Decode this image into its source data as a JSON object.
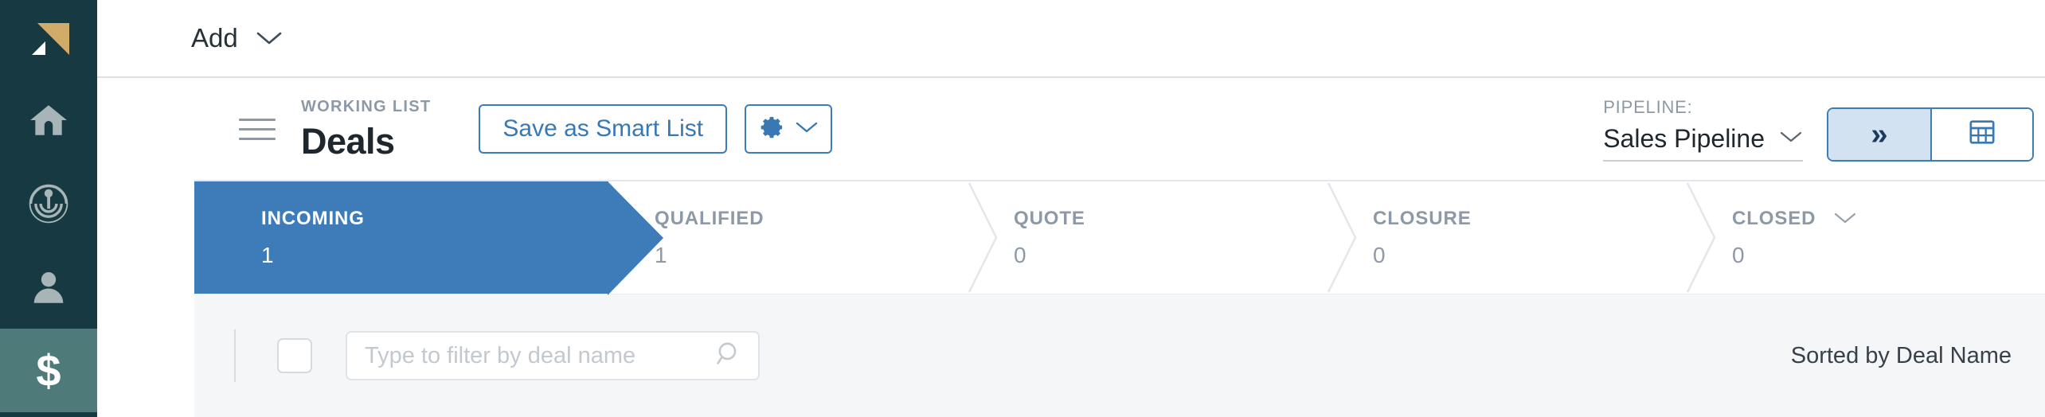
{
  "sidebar": {
    "logo": {
      "icon": "brand-triangle-logo",
      "gold": "#d2ab68"
    },
    "items": [
      {
        "icon": "home-icon",
        "name": "home",
        "active": false
      },
      {
        "icon": "broadcast-icon",
        "name": "marketing",
        "active": false
      },
      {
        "icon": "person-icon",
        "name": "contacts",
        "active": false
      },
      {
        "icon": "dollar-icon",
        "name": "deals",
        "active": true,
        "glyph": "$"
      }
    ],
    "background": "#173a42",
    "active_background": "#4e7a7a"
  },
  "topbar": {
    "add_label": "Add",
    "add_chevron_icon": "chevron-down-icon"
  },
  "listbar": {
    "menu_icon": "hamburger-icon",
    "kicker": "WORKING LIST",
    "title": "Deals",
    "save_smart_list_label": "Save as Smart List",
    "gear_icon": "gear-icon",
    "gear_chevron_icon": "chevron-down-icon",
    "pipeline": {
      "label": "PIPELINE:",
      "value": "Sales Pipeline",
      "chevron_icon": "chevron-down-icon"
    },
    "view_toggle": {
      "pipeline_view_icon": "double-chevron-right-icon",
      "pipeline_view_glyph": "»",
      "table_view_icon": "table-grid-icon",
      "active": "pipeline_view"
    },
    "accent": "#3e7cb9"
  },
  "stages": [
    {
      "name": "INCOMING",
      "count": "1",
      "active": true
    },
    {
      "name": "QUALIFIED",
      "count": "1",
      "active": false
    },
    {
      "name": "QUOTE",
      "count": "0",
      "active": false
    },
    {
      "name": "CLOSURE",
      "count": "0",
      "active": false
    },
    {
      "name": "CLOSED",
      "count": "0",
      "active": false,
      "chevron_icon": "chevron-down-icon"
    }
  ],
  "filterbar": {
    "select_all_checkbox": "",
    "search_placeholder": "Type to filter by deal name",
    "search_value": "",
    "search_icon": "search-icon",
    "sorted_label": "Sorted by Deal Name",
    "background": "#f4f6f8"
  }
}
